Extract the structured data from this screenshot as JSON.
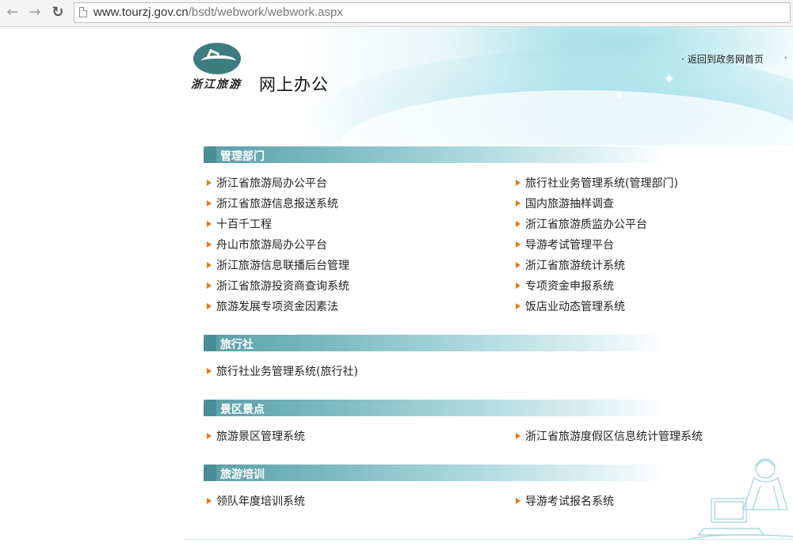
{
  "browser": {
    "url_host": "www.tourzj.gov.cn",
    "url_path": "/bsdt/webwork/webwork.aspx"
  },
  "header": {
    "logo_text": "浙江旅游",
    "title": "网上办公",
    "back_link": "返回到政务网首页"
  },
  "sections": [
    {
      "title": "管理部门",
      "left": [
        "浙江省旅游局办公平台",
        "浙江省旅游信息报送系统",
        "十百千工程",
        "舟山市旅游局办公平台",
        "浙江旅游信息联播后台管理",
        "浙江省旅游投资商查询系统",
        "旅游发展专项资金因素法"
      ],
      "right": [
        "旅行社业务管理系统(管理部门)",
        "国内旅游抽样调查",
        "浙江省旅游质监办公平台",
        "导游考试管理平台",
        "浙江省旅游统计系统",
        "专项资金申报系统",
        "饭店业动态管理系统"
      ]
    },
    {
      "title": "旅行社",
      "left": [
        "旅行社业务管理系统(旅行社)"
      ],
      "right": []
    },
    {
      "title": "景区景点",
      "left": [
        "旅游景区管理系统"
      ],
      "right": [
        "浙江省旅游度假区信息统计管理系统"
      ]
    },
    {
      "title": "旅游培训",
      "left": [
        "领队年度培训系统"
      ],
      "right": [
        "导游考试报名系统"
      ]
    }
  ],
  "colors": {
    "section_bar": "#5a9ea7",
    "arrow": "#e07a18"
  }
}
